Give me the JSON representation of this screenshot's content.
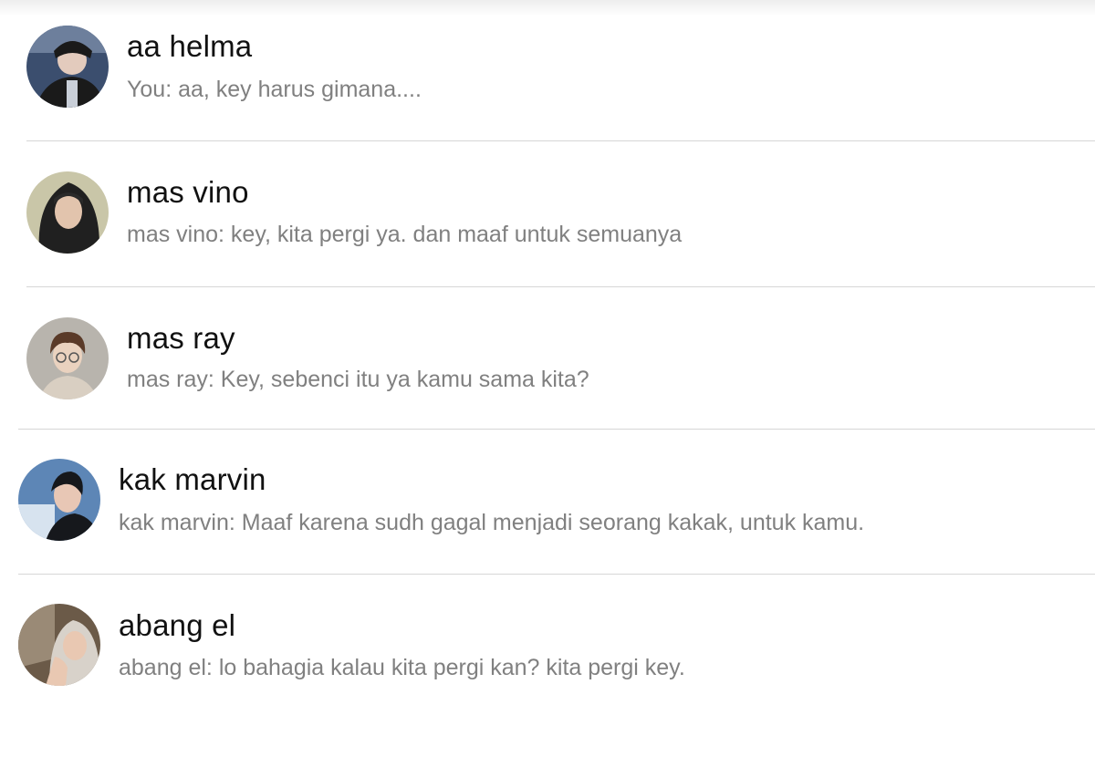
{
  "conversations": [
    {
      "name": "aa helma",
      "preview": "You: aa, key harus gimana....",
      "avatar_icon": "avatar-photo-dark-jacket",
      "avatar_colors": [
        "#3b4e6e",
        "#1a1a1a",
        "#8c9cb5"
      ]
    },
    {
      "name": "mas vino",
      "preview": "mas vino: key, kita pergi ya. dan maaf untuk semuanya",
      "avatar_icon": "avatar-photo-black-hoodie",
      "avatar_colors": [
        "#c9c6a8",
        "#202020",
        "#e2c4ad"
      ]
    },
    {
      "name": "mas ray",
      "preview": "mas ray: Key, sebenci itu ya kamu sama kita?",
      "avatar_icon": "avatar-photo-glasses",
      "avatar_colors": [
        "#b8b4ad",
        "#5a3a28",
        "#ead2bf"
      ]
    },
    {
      "name": "kak marvin",
      "preview": "kak marvin: Maaf karena sudh gagal menjadi seorang kakak, untuk kamu.",
      "avatar_icon": "avatar-photo-blue-light",
      "avatar_colors": [
        "#5d86b6",
        "#16181c",
        "#e8c7b5"
      ]
    },
    {
      "name": "abang el",
      "preview": "abang el: lo bahagia kalau kita pergi kan? kita pergi key.",
      "avatar_icon": "avatar-photo-hood-selfie",
      "avatar_colors": [
        "#6b5a48",
        "#d8d2ca",
        "#e9c8b2"
      ]
    }
  ]
}
